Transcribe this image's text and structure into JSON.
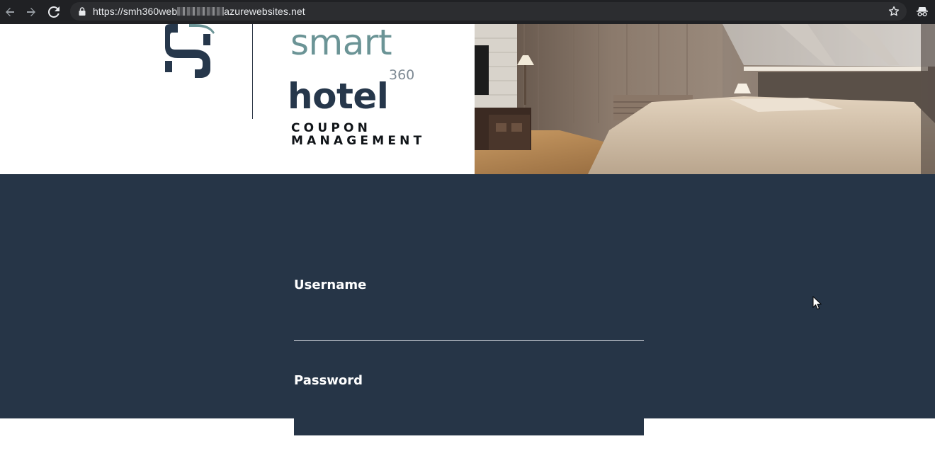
{
  "browser": {
    "url_prefix": "https://smh360web",
    "url_suffix": "azurewebsites.net",
    "icons": [
      "back-arrow-icon",
      "forward-arrow-icon",
      "reload-icon",
      "lock-icon",
      "star-icon",
      "incognito-icon"
    ]
  },
  "header": {
    "brand_smart": "smart",
    "brand_360": "360",
    "brand_hotel": "hotel",
    "tagline_line1": "COUPON",
    "tagline_line2": "MANAGEMENT"
  },
  "login": {
    "username_label": "Username",
    "username_value": "",
    "password_label": "Password",
    "password_value": ""
  },
  "colors": {
    "band": "#263547",
    "brand_teal": "#6b9496",
    "brand_navy": "#26374b"
  }
}
